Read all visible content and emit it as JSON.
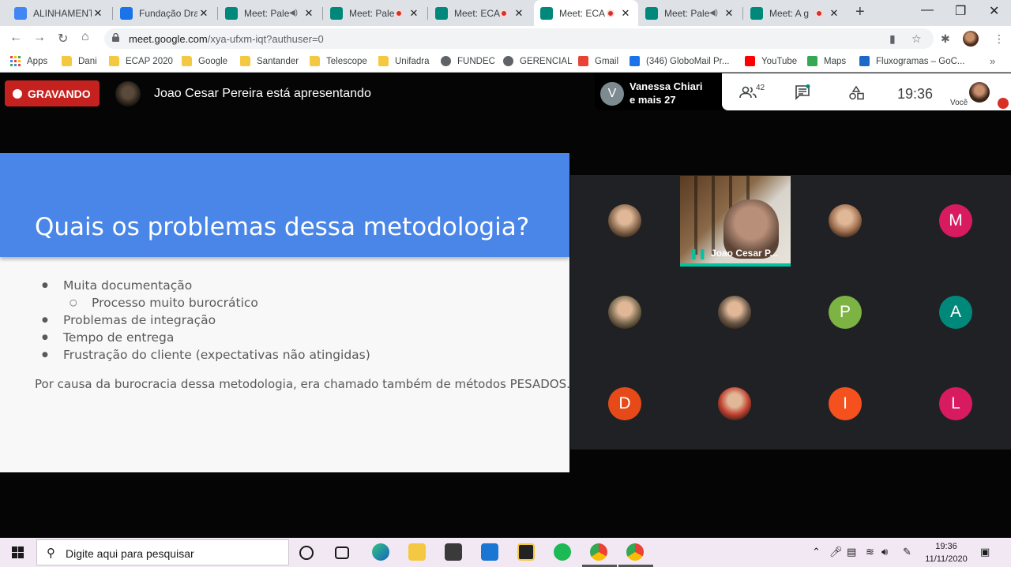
{
  "browser": {
    "tabs": [
      {
        "title": "ALINHAMENTO",
        "state": "",
        "favicon": "docs-icon",
        "color": "#4285f4"
      },
      {
        "title": "Fundação Drac",
        "state": "",
        "favicon": "calendar-icon",
        "color": "#1a73e8"
      },
      {
        "title": "Meet: Pale",
        "state": "audio",
        "favicon": "meet-icon",
        "color": "#00897b"
      },
      {
        "title": "Meet: Pale",
        "state": "recording",
        "favicon": "meet-icon",
        "color": "#00897b"
      },
      {
        "title": "Meet: ECA",
        "state": "recording",
        "favicon": "meet-icon",
        "color": "#00897b"
      },
      {
        "title": "Meet: ECA",
        "state": "recording",
        "favicon": "meet-icon",
        "color": "#00897b"
      },
      {
        "title": "Meet: Pale",
        "state": "audio",
        "favicon": "meet-icon",
        "color": "#00897b"
      },
      {
        "title": "Meet: A g",
        "state": "recording",
        "favicon": "meet-icon",
        "color": "#00897b"
      }
    ],
    "active_tab": 5,
    "url_host": "meet.google.com",
    "url_path": "/xya-ufxm-iqt?authuser=0",
    "bookmarks": [
      {
        "label": "Apps",
        "icon": "apps-grid-icon"
      },
      {
        "label": "Dani",
        "icon": "folder-icon"
      },
      {
        "label": "ECAP 2020",
        "icon": "folder-icon"
      },
      {
        "label": "Google",
        "icon": "folder-icon"
      },
      {
        "label": "Santander",
        "icon": "folder-icon"
      },
      {
        "label": "Telescope",
        "icon": "folder-icon"
      },
      {
        "label": "Unifadra",
        "icon": "folder-icon"
      },
      {
        "label": "FUNDEC",
        "icon": "globe-icon"
      },
      {
        "label": "GERENCIAL",
        "icon": "globe-icon"
      },
      {
        "label": "Gmail",
        "icon": "gmail-icon"
      },
      {
        "label": "(346) GloboMail Pr...",
        "icon": "globomail-icon"
      },
      {
        "label": "YouTube",
        "icon": "youtube-icon"
      },
      {
        "label": "Maps",
        "icon": "maps-icon"
      },
      {
        "label": "Fluxogramas – GoC...",
        "icon": "gocardless-icon"
      }
    ]
  },
  "meet": {
    "recording_label": "GRAVANDO",
    "presenting_text": "Joao Cesar Pereira está apresentando",
    "pinned": {
      "initial": "V",
      "line1": "Vanessa Chiari",
      "line2": "e mais 27"
    },
    "participant_count": "42",
    "time": "19:36",
    "self_label": "Você",
    "video_tile_name": "Joao Cesar P...",
    "participants": [
      {
        "initial": "",
        "color": "#8a6a50",
        "kind": "photo-participant"
      },
      {
        "initial": "",
        "color": "#a07050",
        "kind": "photo-participant"
      },
      {
        "initial": "M",
        "color": "#d81b60",
        "kind": "letter-participant"
      },
      {
        "initial": "",
        "color": "#7a6a50",
        "kind": "photo-participant"
      },
      {
        "initial": "",
        "color": "#6a5848",
        "kind": "photo-participant"
      },
      {
        "initial": "P",
        "color": "#7cb342",
        "kind": "letter-participant"
      },
      {
        "initial": "A",
        "color": "#00897b",
        "kind": "letter-participant"
      },
      {
        "initial": "D",
        "color": "#e64a19",
        "kind": "letter-participant"
      },
      {
        "initial": "",
        "color": "#c04030",
        "kind": "photo-participant"
      },
      {
        "initial": "I",
        "color": "#f4511e",
        "kind": "letter-participant"
      },
      {
        "initial": "L",
        "color": "#d81b60",
        "kind": "letter-participant"
      }
    ]
  },
  "slide": {
    "title": "Quais os problemas dessa metodologia?",
    "bullets": [
      {
        "text": "Muita documentação",
        "level": 1
      },
      {
        "text": "Processo muito burocrático",
        "level": 2
      },
      {
        "text": "Problemas de integração",
        "level": 1
      },
      {
        "text": "Tempo de entrega",
        "level": 1
      },
      {
        "text": "Frustração do cliente (expectativas não atingidas)",
        "level": 1
      }
    ],
    "footnote": "Por causa da burocracia dessa metodologia, era chamado também de métodos PESADOS."
  },
  "taskbar": {
    "search_placeholder": "Digite aqui para pesquisar",
    "time": "19:36",
    "date": "11/11/2020"
  }
}
